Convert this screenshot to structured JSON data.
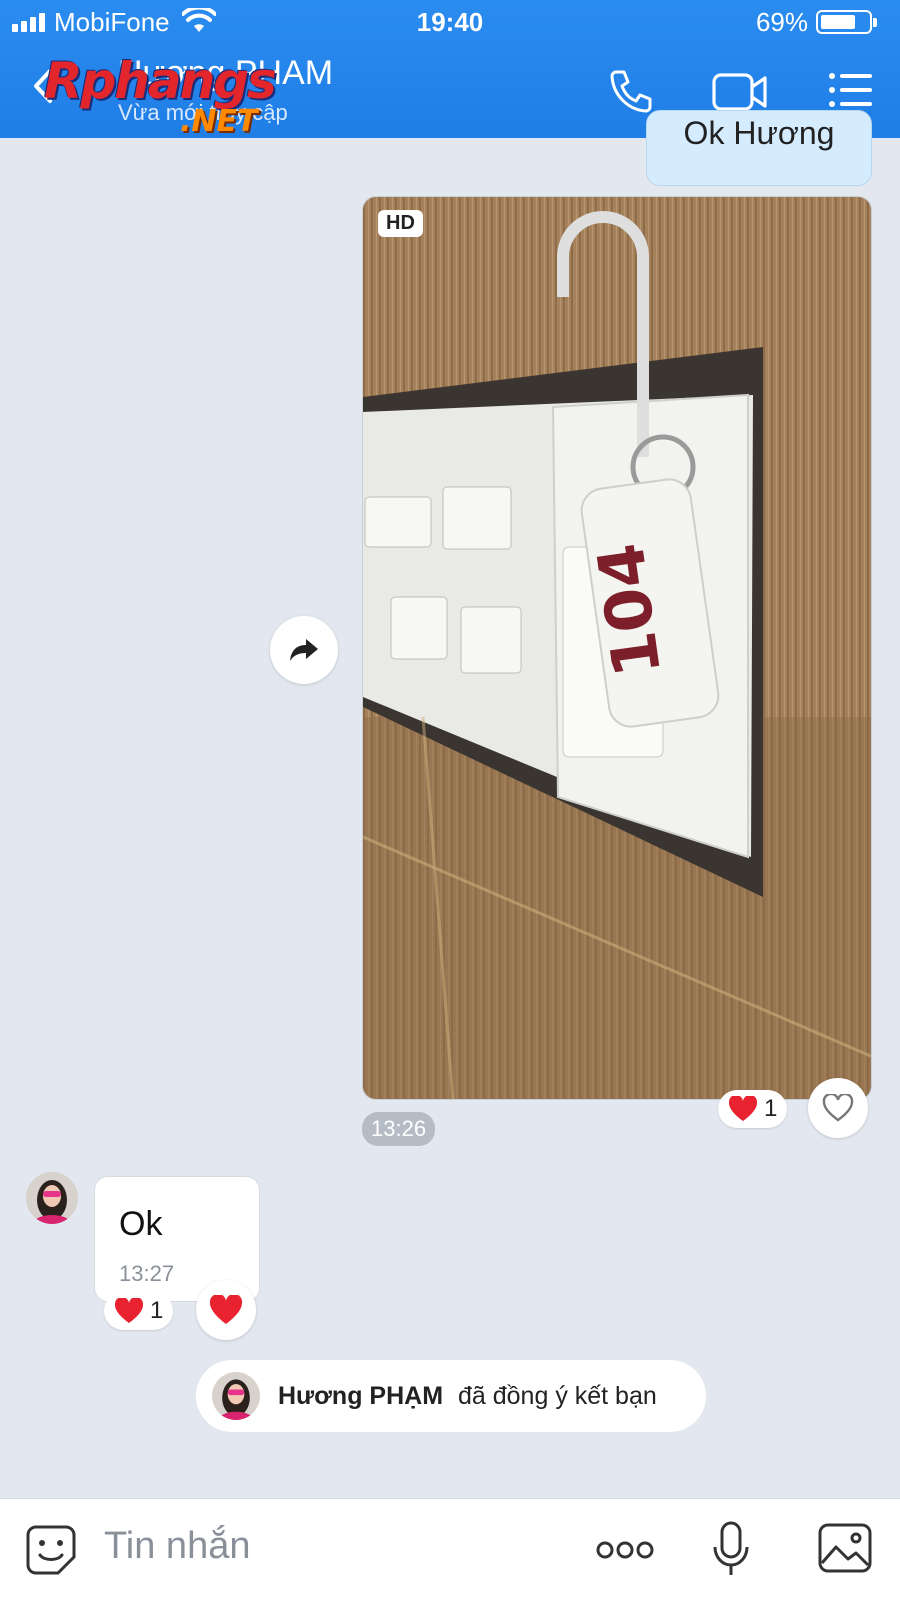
{
  "status_bar": {
    "carrier": "MobiFone",
    "time": "19:40",
    "battery": "69%",
    "battery_level": 0.69
  },
  "header": {
    "contact_name": "Hương PHAM",
    "contact_status": "Vừa mới truy cập",
    "watermark_text": "Rphangs",
    "watermark_suffix": ".NET",
    "icons": [
      "back-icon",
      "phone-icon",
      "video-icon",
      "menu-icon"
    ]
  },
  "messages": {
    "prev_outgoing": {
      "text": "Ok Hương"
    },
    "photo": {
      "badge": "HD",
      "time": "13:26",
      "reaction_count": "1",
      "tag_number": "104"
    },
    "incoming": {
      "text": "Ok",
      "time": "13:27",
      "reaction_count": "1"
    },
    "system": {
      "name": "Hương PHẠM",
      "action": "đã đồng ý kết bạn"
    }
  },
  "input_bar": {
    "placeholder": "Tin nhắn",
    "icons": [
      "sticker-icon",
      "more-icon",
      "microphone-icon",
      "gallery-icon"
    ]
  },
  "colors": {
    "header": "#1f7ee6",
    "bg": "#e3e8f0",
    "outgoing_bubble": "#d5ecff",
    "heart": "#e8232f"
  }
}
